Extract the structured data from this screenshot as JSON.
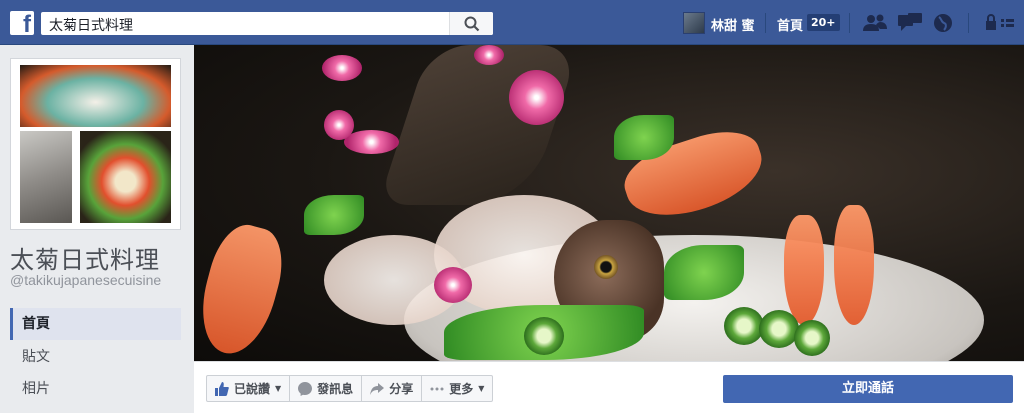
{
  "topbar": {
    "logo": "f",
    "search_value": "太菊日式料理",
    "user_name": "林甜 蜜",
    "home_label": "首頁",
    "home_badge": "20+",
    "icons": [
      "friends-icon",
      "messages-icon",
      "notifications-globe-icon",
      "privacy-lock-icon"
    ]
  },
  "page": {
    "name": "太菊日式料理",
    "handle": "@takikujapanesecuisine"
  },
  "nav": {
    "items": [
      {
        "label": "首頁",
        "active": true
      },
      {
        "label": "貼文",
        "active": false
      },
      {
        "label": "相片",
        "active": false
      }
    ]
  },
  "actions": {
    "like": "已說讚",
    "message": "發訊息",
    "share": "分享",
    "more": "更多",
    "call": "立即通話"
  },
  "colors": {
    "brand": "#3b5998",
    "button_blue": "#4267b2",
    "background": "#e9ebee"
  }
}
